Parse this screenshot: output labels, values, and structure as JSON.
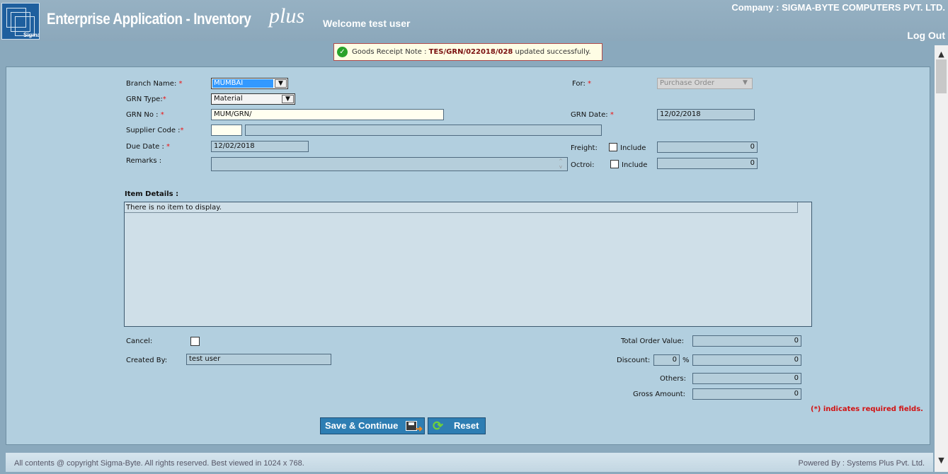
{
  "header": {
    "logo_text": "Sigma Byte",
    "app_title": "Enterprise Application - Inventory",
    "app_suffix": "plus",
    "welcome": "Welcome test user",
    "company": "Company : SIGMA-BYTE COMPUTERS PVT. LTD.",
    "logout": "Log Out"
  },
  "message": {
    "prefix": "Goods Receipt Note : ",
    "doc_no": "TES/GRN/022018/028",
    "suffix": " updated successfully."
  },
  "form": {
    "branch_label": "Branch Name: ",
    "branch_value": "MUMBAI",
    "grn_type_label": "GRN Type:",
    "grn_type_value": "Material",
    "grn_no_label": "GRN No : ",
    "grn_no_value": "MUM/GRN/",
    "supplier_label": "Supplier Code :",
    "supplier_code": "",
    "supplier_name": "",
    "due_date_label": "Due Date : ",
    "due_date_value": "12/02/2018",
    "remarks_label": "Remarks :",
    "remarks_value": "",
    "for_label": "For: ",
    "for_value": "Purchase Order",
    "grn_date_label": "GRN Date: ",
    "grn_date_value": "12/02/2018",
    "freight_label": "Freight:",
    "freight_include": "Include",
    "freight_value": "0",
    "octroi_label": "Octroi:",
    "octroi_include": "Include",
    "octroi_value": "0",
    "required_mark": "*"
  },
  "items": {
    "title": "Item Details :",
    "empty_text": "There is no item to display."
  },
  "summary": {
    "cancel_label": "Cancel:",
    "created_by_label": "Created By:",
    "created_by_value": "test user",
    "total_label": "Total Order Value:",
    "total_value": "0",
    "discount_label": "Discount:",
    "discount_pct": "0",
    "pct_sign": "%",
    "discount_value": "0",
    "others_label": "Others:",
    "others_value": "0",
    "gross_label": "Gross Amount:",
    "gross_value": "0",
    "required_note": "(*) indicates required fields."
  },
  "buttons": {
    "save": "Save & Continue",
    "reset": "Reset"
  },
  "footer": {
    "copyright": "All contents @ copyright Sigma-Byte. All rights reserved. Best viewed in 1024 x 768.",
    "powered": "Powered By : Systems Plus Pvt. Ltd."
  },
  "colors": {
    "required": "#ee1111",
    "button": "#2e7eb3",
    "success": "#2aa32a"
  }
}
